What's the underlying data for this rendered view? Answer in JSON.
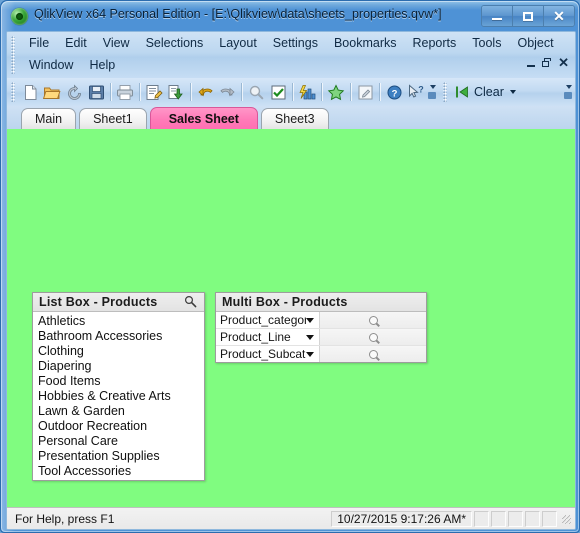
{
  "window": {
    "title": "QlikView x64 Personal Edition - [E:\\Qlikview\\data\\sheets_properties.qvw*]",
    "app_icon": "qlikview-logo-icon",
    "controls": {
      "minimize": "minimize-icon",
      "maximize": "maximize-icon",
      "close": "close-icon"
    }
  },
  "menubar": {
    "row1": [
      {
        "label": "File"
      },
      {
        "label": "Edit"
      },
      {
        "label": "View"
      },
      {
        "label": "Selections"
      },
      {
        "label": "Layout"
      },
      {
        "label": "Settings"
      },
      {
        "label": "Bookmarks"
      },
      {
        "label": "Reports"
      },
      {
        "label": "Tools"
      },
      {
        "label": "Object"
      }
    ],
    "row2": [
      {
        "label": "Window"
      },
      {
        "label": "Help"
      }
    ],
    "mdi_controls": {
      "minimize": "mdi-minimize-icon",
      "restore": "mdi-restore-icon",
      "close": "mdi-close-icon"
    }
  },
  "toolbar": {
    "buttons": [
      {
        "name": "new-document-icon"
      },
      {
        "name": "open-document-icon"
      },
      {
        "name": "reload-document-icon"
      },
      {
        "name": "save-document-icon"
      },
      {
        "name": "print-icon"
      },
      {
        "name": "edit-script-icon"
      },
      {
        "name": "reload-data-icon"
      },
      {
        "name": "undo-icon"
      },
      {
        "name": "redo-icon"
      },
      {
        "name": "search-icon"
      },
      {
        "name": "current-selections-icon"
      },
      {
        "name": "quick-chart-icon"
      },
      {
        "name": "add-bookmark-icon"
      },
      {
        "name": "edit-module-icon"
      },
      {
        "name": "help-icon"
      },
      {
        "name": "context-help-icon"
      }
    ],
    "clear": {
      "label": "Clear",
      "icon": "clear-selections-icon",
      "caret": "chevron-down-icon"
    }
  },
  "tabs": [
    {
      "label": "Main",
      "active": false
    },
    {
      "label": "Sheet1",
      "active": false
    },
    {
      "label": "Sales Sheet",
      "active": true
    },
    {
      "label": "Sheet3",
      "active": false
    }
  ],
  "canvas": {
    "background_color": "#80fc80"
  },
  "listbox": {
    "title": "List Box - Products",
    "search_icon": "magnifier-icon",
    "items": [
      "Athletics",
      "Bathroom Accessories",
      "Clothing",
      "Diapering",
      "Food Items",
      "Hobbies & Creative Arts",
      "Lawn & Garden",
      "Outdoor Recreation",
      "Personal Care",
      "Presentation Supplies",
      "Tool Accessories"
    ]
  },
  "multibox": {
    "title": "Multi Box - Products",
    "rows": [
      {
        "field": "Product_category",
        "value": "",
        "caret": "chevron-down-icon",
        "indicator": "search-circle-icon"
      },
      {
        "field": "Product_Line",
        "value": "",
        "caret": "chevron-down-icon",
        "indicator": "search-circle-icon"
      },
      {
        "field": "Product_Subcat...",
        "value": "",
        "caret": "chevron-down-icon",
        "indicator": "search-circle-icon"
      }
    ]
  },
  "statusbar": {
    "help_text": "For Help, press F1",
    "datetime": "10/27/2015 9:17:26 AM*",
    "panes": [
      "",
      "",
      "",
      "",
      ""
    ],
    "grip": "resize-grip-icon"
  }
}
